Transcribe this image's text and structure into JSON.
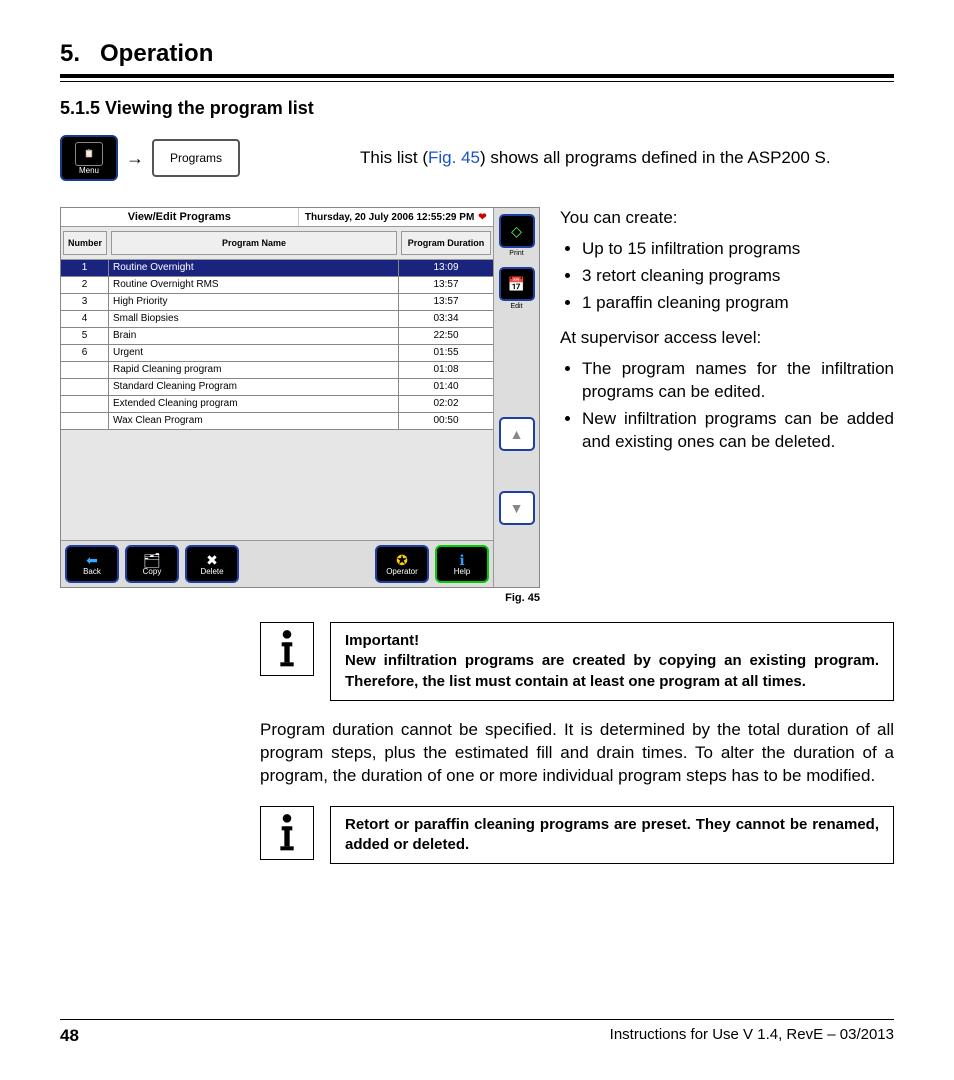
{
  "chapter": {
    "number": "5.",
    "title": "Operation"
  },
  "section": {
    "number_title": "5.1.5 Viewing the program list"
  },
  "intro": {
    "menu_label": "Menu",
    "arrow": "→",
    "programs_label": "Programs",
    "text_pre": "This list (",
    "fig_link": "Fig. 45",
    "text_post": ") shows all programs defined in the ASP200 S."
  },
  "screenshot": {
    "window_title": "View/Edit Programs",
    "datetime": "Thursday, 20 July 2006 12:55:29 PM",
    "headers": {
      "number": "Number",
      "name": "Program Name",
      "duration": "Program Duration"
    },
    "rows": [
      {
        "num": "1",
        "name": "Routine Overnight",
        "dur": "13:09",
        "selected": true
      },
      {
        "num": "2",
        "name": "Routine Overnight RMS",
        "dur": "13:57"
      },
      {
        "num": "3",
        "name": "High Priority",
        "dur": "13:57"
      },
      {
        "num": "4",
        "name": "Small Biopsies",
        "dur": "03:34"
      },
      {
        "num": "5",
        "name": "Brain",
        "dur": "22:50"
      },
      {
        "num": "6",
        "name": "Urgent",
        "dur": "01:55"
      },
      {
        "num": "",
        "name": "Rapid Cleaning program",
        "dur": "01:08"
      },
      {
        "num": "",
        "name": "Standard Cleaning Program",
        "dur": "01:40"
      },
      {
        "num": "",
        "name": "Extended Cleaning program",
        "dur": "02:02"
      },
      {
        "num": "",
        "name": "Wax Clean Program",
        "dur": "00:50"
      }
    ],
    "side": {
      "print": "Print",
      "edit": "Edit"
    },
    "bottom": {
      "back": "Back",
      "copy": "Copy",
      "delete": "Delete",
      "operator": "Operator",
      "help": "Help"
    },
    "caption": "Fig. 45"
  },
  "right": {
    "create_intro": "You can create:",
    "create_items": [
      "Up to 15 infiltration programs",
      "3 retort cleaning programs",
      "1 paraffin cleaning program"
    ],
    "supervisor_intro": "At supervisor access level:",
    "supervisor_items": [
      "The program names for the infiltration programs can be edited.",
      "New infiltration programs can be added and existing ones can be deleted."
    ]
  },
  "note1": {
    "title": "Important!",
    "body": "New infiltration programs are created by copying an existing program. Therefore, the list must contain at least one program at all times."
  },
  "para": "Program duration cannot be specified. It is determined by the total duration of all program steps, plus the estimated fill and drain times. To alter the duration of a program, the duration of one or more individual program steps has to be modified.",
  "note2": {
    "body": "Retort or paraffin cleaning programs are preset. They cannot be renamed, added or deleted."
  },
  "footer": {
    "page": "48",
    "doc": "Instructions for Use V 1.4, RevE – 03/2013"
  }
}
